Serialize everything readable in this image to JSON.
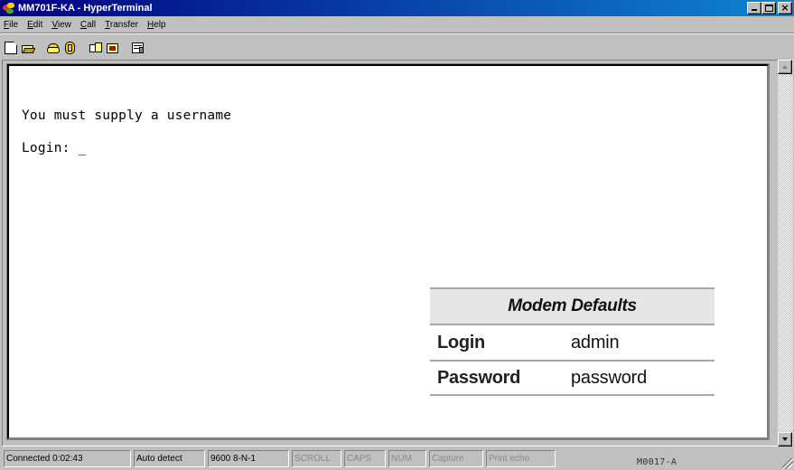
{
  "window": {
    "title": "MM701F-KA - HyperTerminal"
  },
  "menu": [
    {
      "label": "File",
      "accel": "F",
      "rest": "ile"
    },
    {
      "label": "Edit",
      "accel": "E",
      "rest": "dit"
    },
    {
      "label": "View",
      "accel": "V",
      "rest": "iew"
    },
    {
      "label": "Call",
      "accel": "C",
      "rest": "all"
    },
    {
      "label": "Transfer",
      "accel": "T",
      "rest": "ransfer"
    },
    {
      "label": "Help",
      "accel": "H",
      "rest": "elp"
    }
  ],
  "toolbar": {
    "icons": [
      "new-file-icon",
      "open-folder-icon",
      "call-phone-icon",
      "disconnect-icon",
      "send-file-icon",
      "receive-file-icon",
      "properties-icon"
    ]
  },
  "terminal": {
    "line1": "You must supply a username",
    "line2_prompt": "Login: ",
    "cursor": "_"
  },
  "modem_defaults": {
    "heading": "Modem Defaults",
    "rows": [
      {
        "key": "Login",
        "value": "admin"
      },
      {
        "key": "Password",
        "value": "password"
      }
    ]
  },
  "statusbar": {
    "connected": "Connected 0:02:43",
    "detect": "Auto detect",
    "settings": "9600 8-N-1",
    "scroll": "SCROLL",
    "caps": "CAPS",
    "num": "NUM",
    "capture": "Capture",
    "print_echo": "Print echo"
  },
  "figure_code": "M0017-A",
  "colors": {
    "titlebar_start": "#000080",
    "titlebar_end": "#1084d0",
    "terminal_bg": "#ffffff",
    "chrome": "#c0c0c0"
  }
}
